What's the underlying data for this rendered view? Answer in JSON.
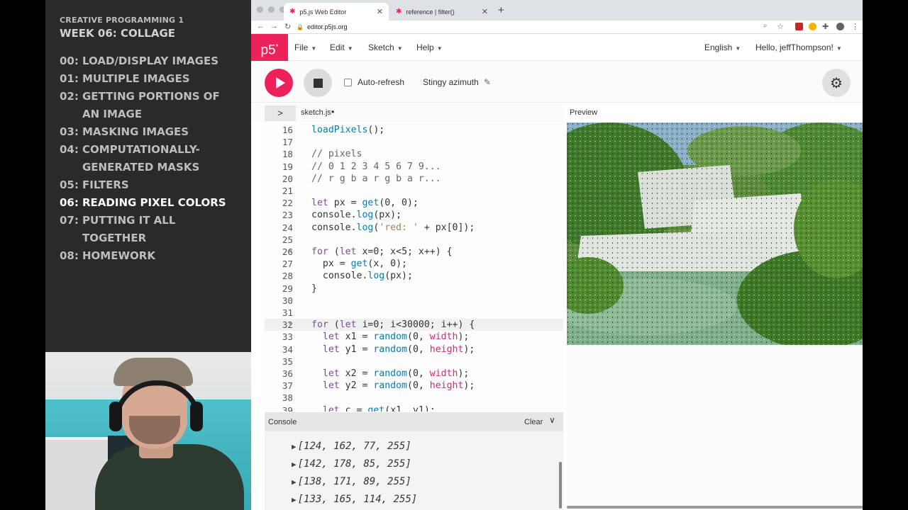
{
  "slide": {
    "course": "CREATIVE PROGRAMMING 1",
    "week": "WEEK 06: COLLAGE",
    "items": [
      {
        "num": "00:",
        "label": "LOAD/DISPLAY IMAGES"
      },
      {
        "num": "01:",
        "label": "MULTIPLE IMAGES"
      },
      {
        "num": "02:",
        "label": "GETTING PORTIONS OF AN IMAGE"
      },
      {
        "num": "03:",
        "label": "MASKING IMAGES"
      },
      {
        "num": "04:",
        "label": "COMPUTATIONALLY-GENERATED MASKS"
      },
      {
        "num": "05:",
        "label": "FILTERS"
      },
      {
        "num": "06:",
        "label": "READING PIXEL COLORS"
      },
      {
        "num": "07:",
        "label": "PUTTING IT ALL TOGETHER"
      },
      {
        "num": "08:",
        "label": "HOMEWORK"
      }
    ],
    "active_index": 6
  },
  "browser": {
    "tabs": [
      {
        "title": "p5.js Web Editor"
      },
      {
        "title": "reference | filter()"
      }
    ],
    "url": "editor.p5js.org"
  },
  "p5": {
    "logo": "p5",
    "logo_sup": "*",
    "menu": [
      "File",
      "Edit",
      "Sketch",
      "Help"
    ],
    "language": "English",
    "user": "Hello, jeffThompson!",
    "auto_refresh": "Auto-refresh",
    "sketch_name": "Stingy azimuth",
    "file_name": "sketch.js",
    "preview_label": "Preview",
    "console_title": "Console",
    "console_clear": "Clear"
  },
  "code_lines": [
    {
      "n": "16",
      "text": "loadPixels();"
    },
    {
      "n": "17",
      "text": ""
    },
    {
      "n": "18",
      "text": "// pixels"
    },
    {
      "n": "19",
      "text": "// 0 1 2 3 4 5 6 7 9..."
    },
    {
      "n": "20",
      "text": "// r g b a r g b a r..."
    },
    {
      "n": "21",
      "text": ""
    },
    {
      "n": "22",
      "text": "let px = get(0, 0);"
    },
    {
      "n": "23",
      "text": "console.log(px);"
    },
    {
      "n": "24",
      "text": "console.log('red: ' + px[0]);"
    },
    {
      "n": "25",
      "text": ""
    },
    {
      "n": "26",
      "text": "for (let x=0; x<5; x++) {"
    },
    {
      "n": "27",
      "text": "  px = get(x, 0);"
    },
    {
      "n": "28",
      "text": "  console.log(px);"
    },
    {
      "n": "29",
      "text": "}"
    },
    {
      "n": "30",
      "text": ""
    },
    {
      "n": "31",
      "text": ""
    },
    {
      "n": "32",
      "text": "for (let i=0; i<30000; i++) {"
    },
    {
      "n": "33",
      "text": "  let x1 = random(0, width);"
    },
    {
      "n": "34",
      "text": "  let y1 = random(0, height);"
    },
    {
      "n": "35",
      "text": ""
    },
    {
      "n": "36",
      "text": "  let x2 = random(0, width);"
    },
    {
      "n": "37",
      "text": "  let y2 = random(0, height);"
    },
    {
      "n": "38",
      "text": ""
    },
    {
      "n": "39",
      "text": "  let c = get(x1, y1);"
    }
  ],
  "console_lines": [
    "[124, 162, 77, 255]",
    "[142, 178, 85, 255]",
    "[138, 171, 89, 255]",
    "[133, 165, 114, 255]"
  ],
  "colors": {
    "p5_pink": "#ed225d",
    "slide_bg": "#2b2a2a",
    "keyword": "#7a4d98",
    "function": "#0b7ca9",
    "variable": "#d7266e"
  }
}
